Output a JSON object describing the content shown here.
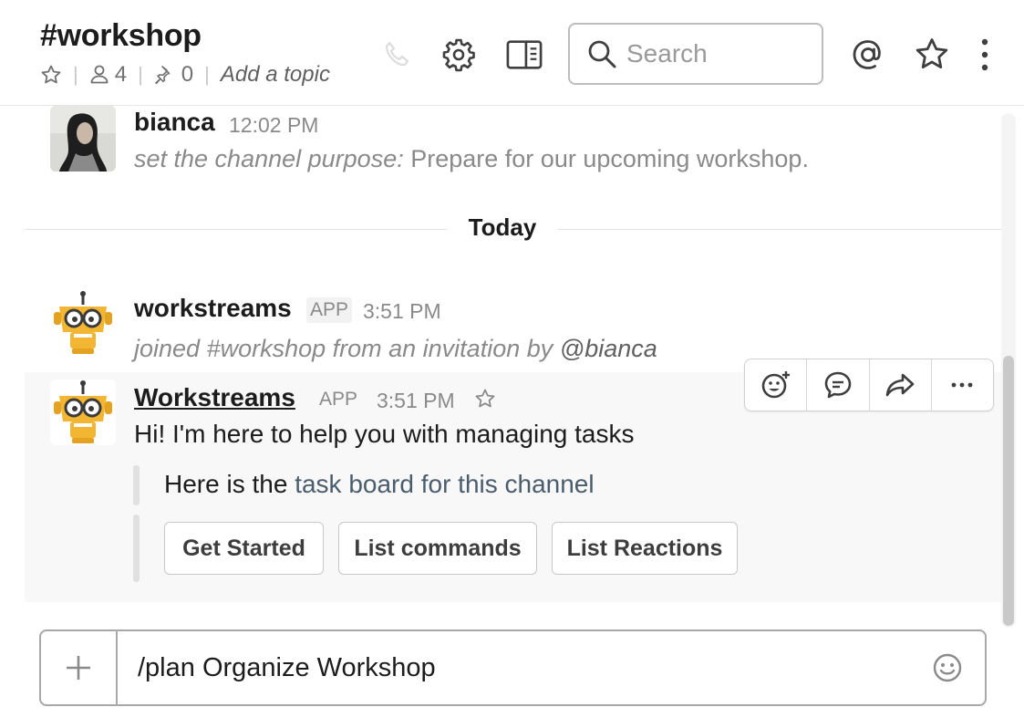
{
  "header": {
    "channel_name": "#workshop",
    "member_count": "4",
    "pinned_count": "0",
    "topic_placeholder": "Add a topic",
    "search_placeholder": "Search"
  },
  "messages": [
    {
      "author": "bianca",
      "time": "12:02 PM",
      "action": "set the channel purpose:",
      "text": "Prepare for our upcoming workshop."
    },
    {
      "author": "workstreams",
      "badge": "APP",
      "time": "3:51 PM",
      "text_prefix": "joined #workshop from an invitation by",
      "mention": "@bianca"
    },
    {
      "author": "Workstreams",
      "badge": "APP",
      "time": "3:51 PM",
      "text": "Hi! I'm here to help you with managing tasks",
      "attachment_prefix": "Here is the",
      "attachment_link": "task board for this channel",
      "buttons": [
        "Get Started",
        "List commands",
        "List Reactions"
      ]
    }
  ],
  "divider_label": "Today",
  "composer": {
    "value": "/plan Organize Workshop"
  },
  "colors": {
    "bot_yellow": "#f2b632",
    "link": "#4a5d6e",
    "muted": "#8a8a8a"
  },
  "icons": [
    "star-icon",
    "members-icon",
    "pin-icon",
    "phone-icon",
    "gear-icon",
    "sidebar-icon",
    "search-icon",
    "at-icon",
    "star-icon",
    "more-vertical-icon",
    "add-reaction-icon",
    "reply-thread-icon",
    "share-icon",
    "more-actions-icon",
    "plus-icon",
    "emoji-icon"
  ]
}
